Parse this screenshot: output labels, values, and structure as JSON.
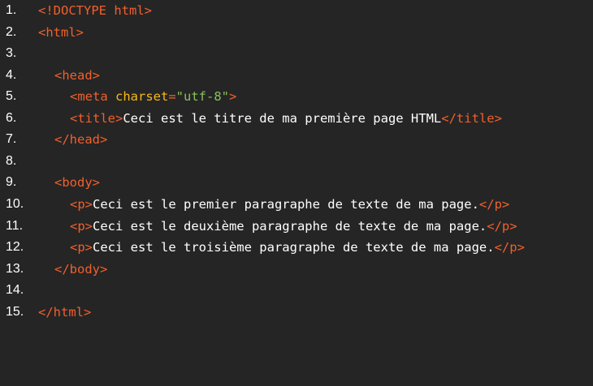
{
  "editor": {
    "lines": [
      {
        "number": "1.",
        "tokens": [
          {
            "type": "tag",
            "text": "<!DOCTYPE html>"
          }
        ]
      },
      {
        "number": "2.",
        "tokens": [
          {
            "type": "tag",
            "text": "<html>"
          }
        ]
      },
      {
        "number": "3.",
        "tokens": []
      },
      {
        "number": "4.",
        "tokens": [
          {
            "type": "tag",
            "text": "<head>"
          }
        ]
      },
      {
        "number": "5.",
        "tokens": [
          {
            "type": "tag",
            "text": "<meta "
          },
          {
            "type": "attr",
            "text": "charset"
          },
          {
            "type": "tag",
            "text": "="
          },
          {
            "type": "str",
            "text": "\"utf-8\""
          },
          {
            "type": "tag",
            "text": ">"
          }
        ]
      },
      {
        "number": "6.",
        "tokens": [
          {
            "type": "tag",
            "text": "<title>"
          },
          {
            "type": "txt",
            "text": "Ceci est le titre de ma première page HTML"
          },
          {
            "type": "tag",
            "text": "</title>"
          }
        ]
      },
      {
        "number": "7.",
        "tokens": [
          {
            "type": "tag",
            "text": "</head>"
          }
        ]
      },
      {
        "number": "8.",
        "tokens": []
      },
      {
        "number": "9.",
        "tokens": [
          {
            "type": "tag",
            "text": "<body>"
          }
        ]
      },
      {
        "number": "10.",
        "tokens": [
          {
            "type": "tag",
            "text": "<p>"
          },
          {
            "type": "txt",
            "text": "Ceci est le premier paragraphe de texte de ma page."
          },
          {
            "type": "tag",
            "text": "</p>"
          }
        ]
      },
      {
        "number": "11.",
        "tokens": [
          {
            "type": "tag",
            "text": "<p>"
          },
          {
            "type": "txt",
            "text": "Ceci est le deuxième paragraphe de texte de ma page."
          },
          {
            "type": "tag",
            "text": "</p>"
          }
        ]
      },
      {
        "number": "12.",
        "tokens": [
          {
            "type": "tag",
            "text": "<p>"
          },
          {
            "type": "txt",
            "text": "Ceci est le troisième paragraphe de texte de ma page."
          },
          {
            "type": "tag",
            "text": "</p>"
          }
        ]
      },
      {
        "number": "13.",
        "tokens": [
          {
            "type": "tag",
            "text": "</body>"
          }
        ]
      },
      {
        "number": "14.",
        "tokens": []
      },
      {
        "number": "15.",
        "tokens": [
          {
            "type": "tag",
            "text": "</html>"
          }
        ]
      }
    ]
  },
  "colors": {
    "background": "#252525",
    "tag": "#f0602c",
    "attribute": "#f8b81c",
    "string": "#86c25a",
    "text": "#ffffff",
    "line_number": "#ffffff"
  }
}
